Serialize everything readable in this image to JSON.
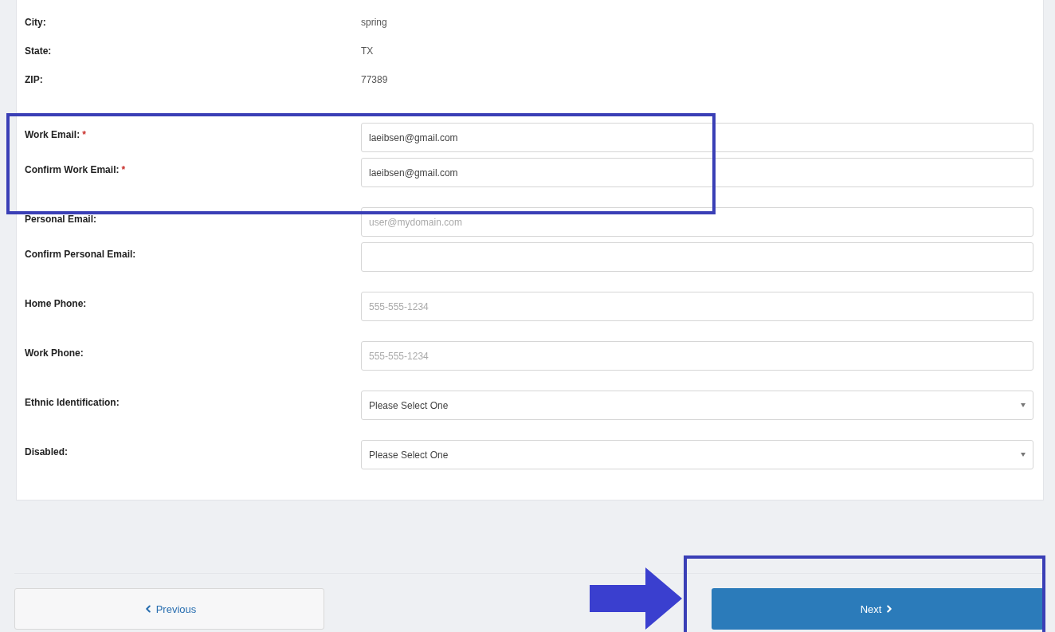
{
  "details": [
    {
      "label": "City:",
      "value": "spring"
    },
    {
      "label": "State:",
      "value": "TX"
    },
    {
      "label": "ZIP:",
      "value": "77389"
    }
  ],
  "field_groups": [
    [
      {
        "kind": "input",
        "label": "Work Email:",
        "required_mark": "*",
        "value": "laeibsen@gmail.com"
      },
      {
        "kind": "input",
        "label": "Confirm Work Email:",
        "required_mark": "*",
        "value": "laeibsen@gmail.com"
      }
    ],
    [
      {
        "kind": "input",
        "label": "Personal Email:",
        "placeholder": "user@mydomain.com"
      },
      {
        "kind": "input",
        "label": "Confirm Personal Email:"
      }
    ],
    [
      {
        "kind": "input",
        "label": "Home Phone:",
        "placeholder": "555-555-1234"
      }
    ],
    [
      {
        "kind": "input",
        "label": "Work Phone:",
        "placeholder": "555-555-1234"
      }
    ],
    [
      {
        "kind": "select",
        "label": "Ethnic Identification:",
        "value": "Please Select One"
      }
    ],
    [
      {
        "kind": "select",
        "label": "Disabled:",
        "value": "Please Select One"
      }
    ]
  ],
  "buttons": {
    "previous": "Previous",
    "next": "Next"
  }
}
